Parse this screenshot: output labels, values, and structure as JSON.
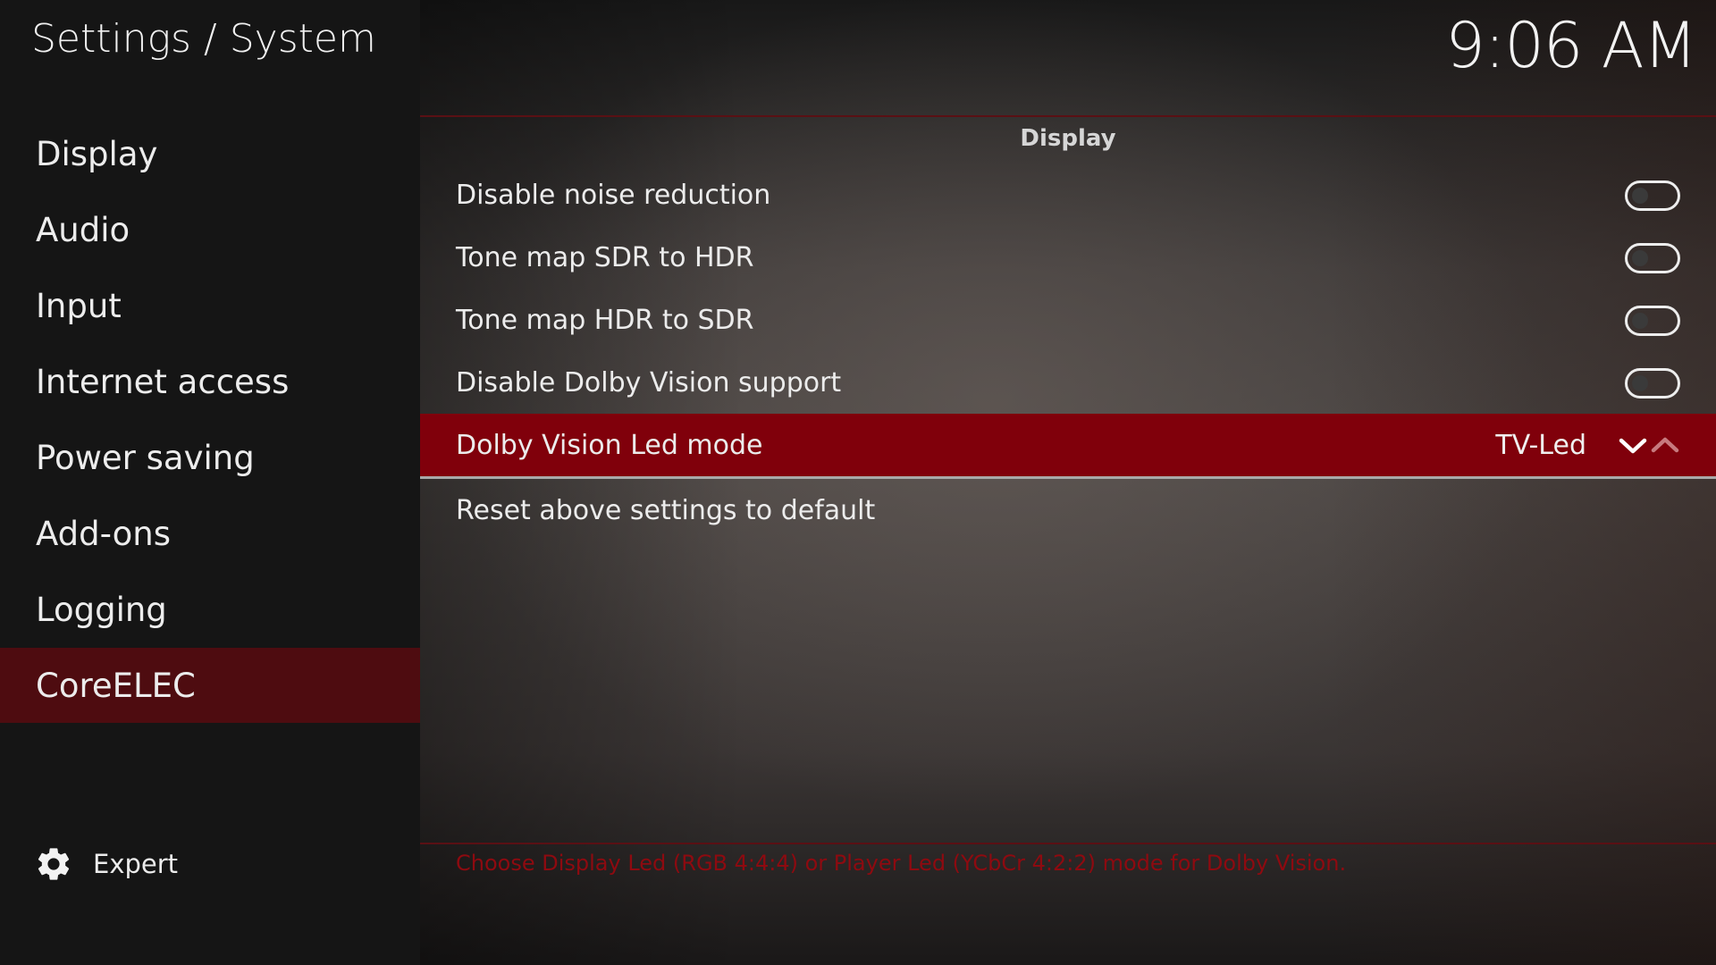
{
  "header": {
    "title": "Settings / System",
    "clock": "9:06 AM"
  },
  "sidebar": {
    "items": [
      {
        "label": "Display"
      },
      {
        "label": "Audio"
      },
      {
        "label": "Input"
      },
      {
        "label": "Internet access"
      },
      {
        "label": "Power saving"
      },
      {
        "label": "Add-ons"
      },
      {
        "label": "Logging"
      },
      {
        "label": "CoreELEC"
      }
    ],
    "active_index": 7,
    "expert_label": "Expert"
  },
  "main": {
    "section_title": "Display",
    "settings": [
      {
        "label": "Disable noise reduction",
        "type": "toggle",
        "enabled": false
      },
      {
        "label": "Tone map SDR to HDR",
        "type": "toggle",
        "enabled": false
      },
      {
        "label": "Tone map HDR to SDR",
        "type": "toggle",
        "enabled": false
      },
      {
        "label": "Disable Dolby Vision support",
        "type": "toggle",
        "enabled": false
      },
      {
        "label": "Dolby Vision Led mode",
        "type": "spinner",
        "value": "TV-Led"
      },
      {
        "label": "Reset above settings to default",
        "type": "action"
      }
    ],
    "help_text": "Choose Display Led (RGB 4:4:4) or Player Led (YCbCr 4:2:2) mode for Dolby Vision."
  },
  "colors": {
    "accent": "#80000b",
    "sidebar_active": "#4e0c10",
    "help_text": "#8e0a10"
  }
}
